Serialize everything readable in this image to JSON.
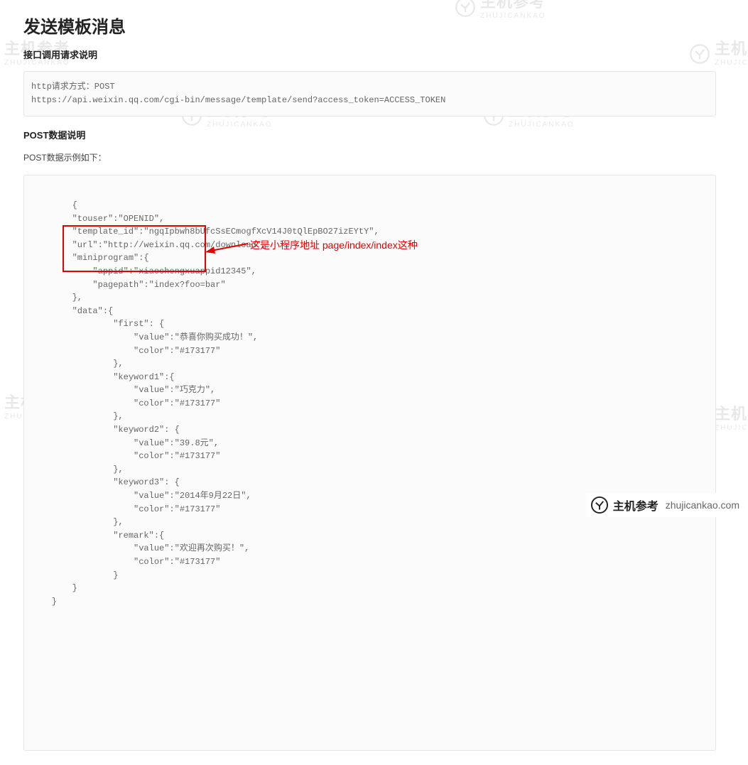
{
  "page": {
    "title": "发送模板消息",
    "section_request_heading": "接口调用请求说明",
    "request_code": "http请求方式：POST\nhttps://api.weixin.qq.com/cgi-bin/message/template/send?access_token=ACCESS_TOKEN",
    "section_post_heading": "POST数据说明",
    "post_example_label": "POST数据示例如下：",
    "json_code": "    {\n        \"touser\":\"OPENID\",\n        \"template_id\":\"ngqIpbwh8bUfcSsECmogfXcV14J0tQlEpBO27izEYtY\",\n        \"url\":\"http://weixin.qq.com/download\",\n        \"miniprogram\":{\n            \"appid\":\"xiaochengxuappid12345\",\n            \"pagepath\":\"index?foo=bar\"\n        },\n        \"data\":{\n                \"first\": {\n                    \"value\":\"恭喜你购买成功！\",\n                    \"color\":\"#173177\"\n                },\n                \"keyword1\":{\n                    \"value\":\"巧克力\",\n                    \"color\":\"#173177\"\n                },\n                \"keyword2\": {\n                    \"value\":\"39.8元\",\n                    \"color\":\"#173177\"\n                },\n                \"keyword3\": {\n                    \"value\":\"2014年9月22日\",\n                    \"color\":\"#173177\"\n                },\n                \"remark\":{\n                    \"value\":\"欢迎再次购买！\",\n                    \"color\":\"#173177\"\n                }\n        }\n    }",
    "annotation_text": "这是小程序地址 page/index/index这种"
  },
  "watermark": {
    "brand_cn": "主机参考",
    "brand_en": "ZHUJICANKAO",
    "small_url": "zhujicankao.com",
    "footer_url": "zhujicankao.com"
  }
}
